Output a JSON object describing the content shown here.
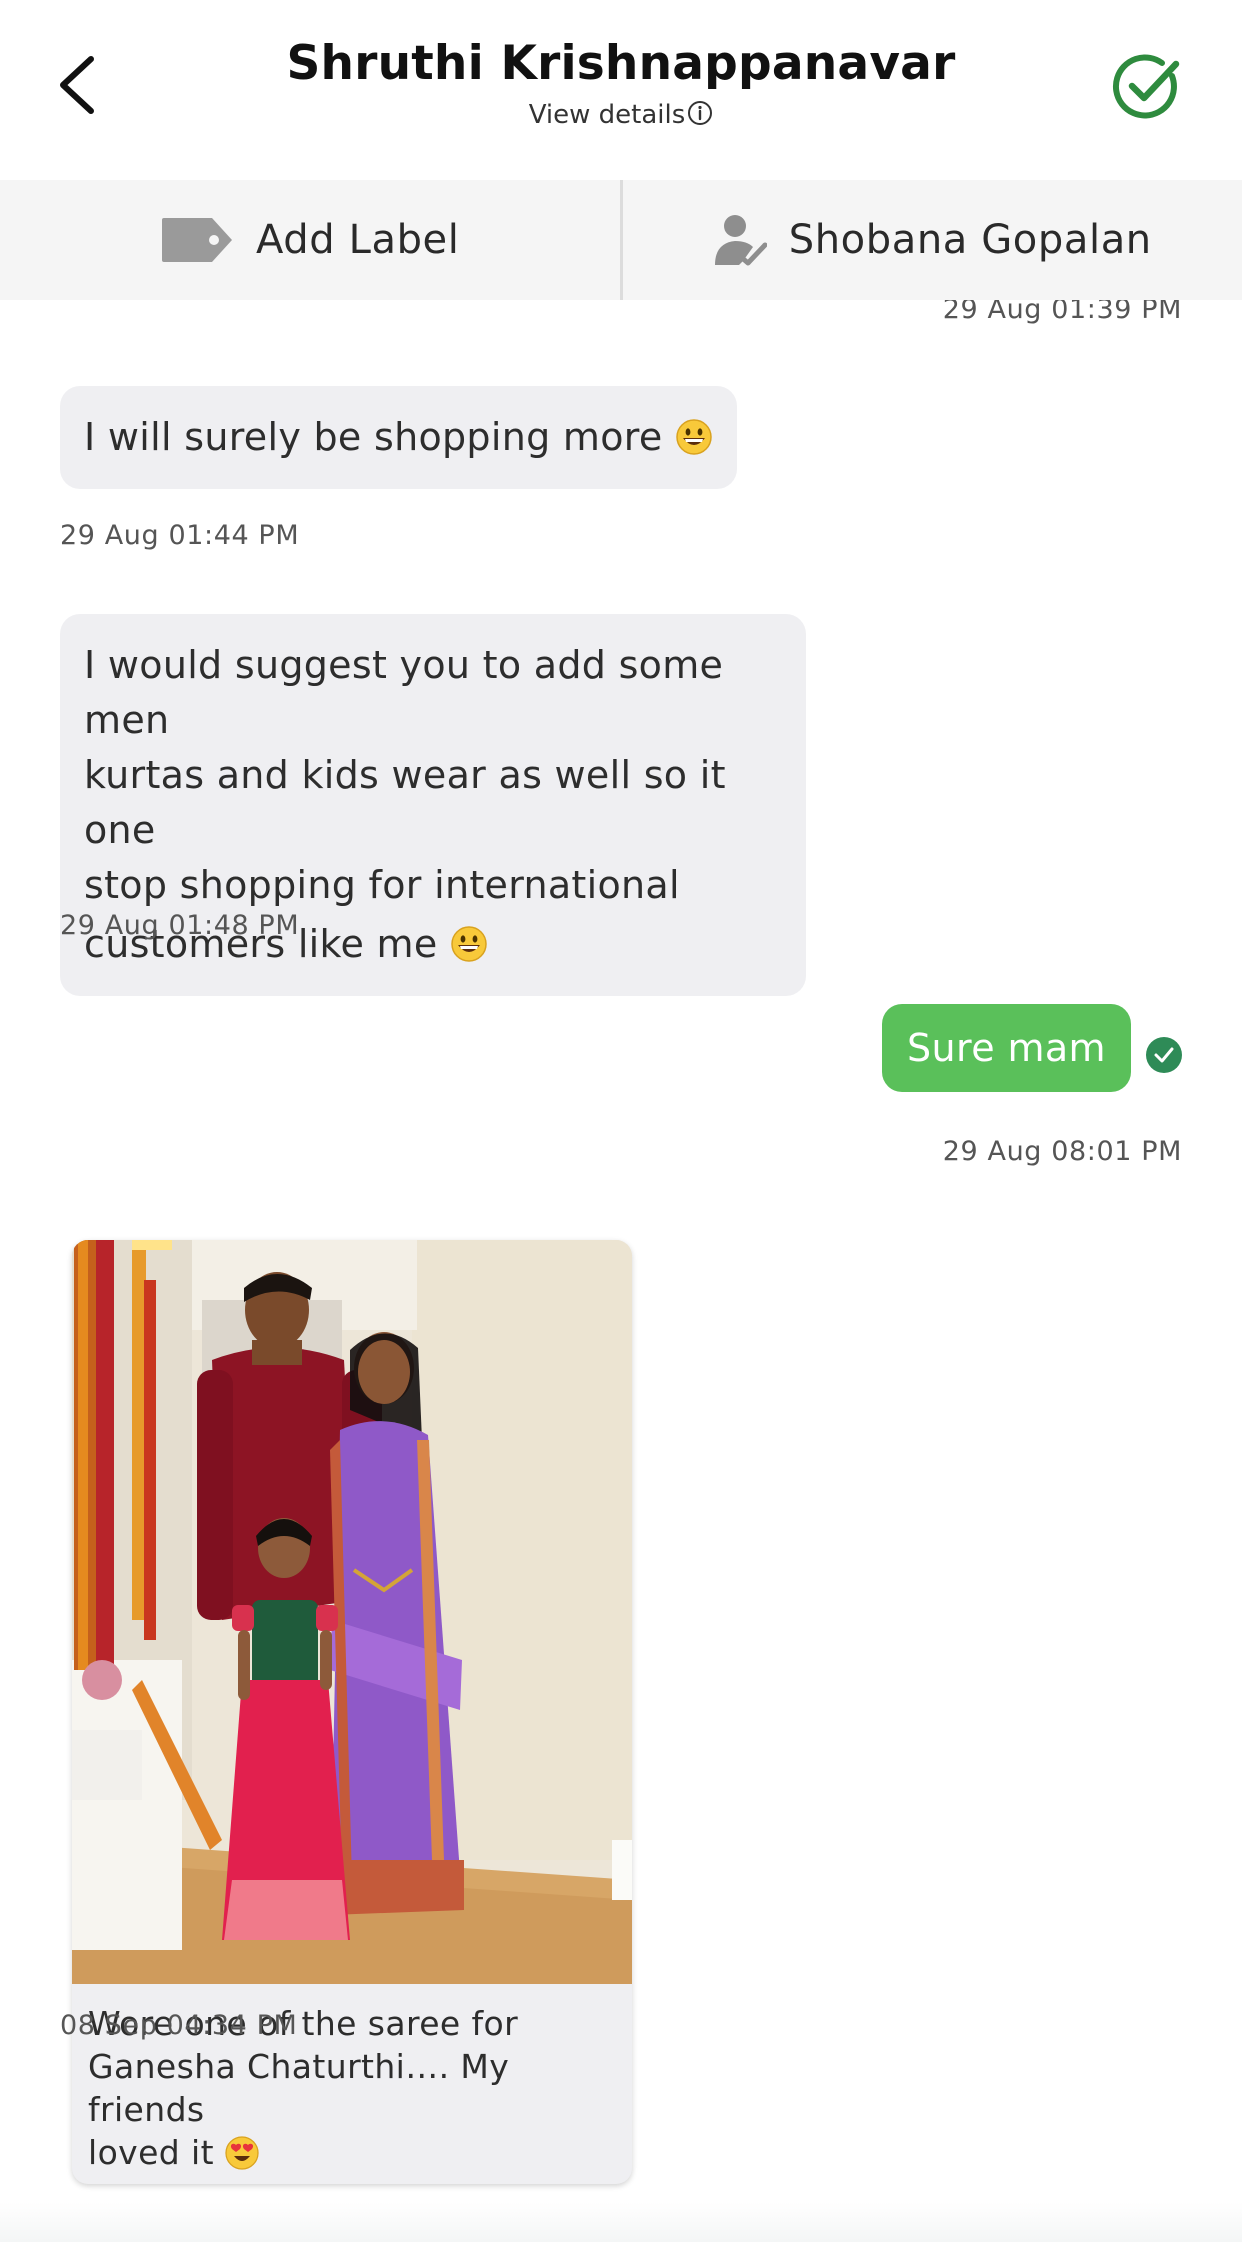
{
  "header": {
    "title": "Shruthi Krishnappanavar",
    "view_details": "View details"
  },
  "actionbar": {
    "label_action": "Add Label",
    "assignee": "Shobana Gopalan"
  },
  "messages": {
    "top_timestamp": "29 Aug 01:39 PM",
    "m1": {
      "text": "I will surely be shopping more",
      "time": "29 Aug 01:44 PM"
    },
    "m2": {
      "line1": "I would suggest you to add some men",
      "line2": "kurtas and kids wear as well so it one",
      "line3": "stop shopping for international",
      "line4": "customers like me",
      "time": "29 Aug 01:48 PM"
    },
    "m3": {
      "text": "Sure mam",
      "time": "29 Aug 08:01 PM"
    },
    "m4": {
      "caption_line1": "Wore one of the saree for",
      "caption_line2": "Ganesha Chaturthi…. My friends",
      "caption_line3": "loved it",
      "time": "08 Sep 04:34 PM"
    }
  },
  "colors": {
    "accent_green": "#5ac05a",
    "resolve_green": "#2e8b3e",
    "incoming_bubble": "#efeff2",
    "actionbar_bg": "#f5f5f5"
  },
  "icons": {
    "back": "chevron-left-icon",
    "resolve": "check-circle-icon",
    "label": "tag-icon",
    "assignee": "user-check-icon",
    "info": "info-icon",
    "sent": "check-circle-filled-icon"
  }
}
